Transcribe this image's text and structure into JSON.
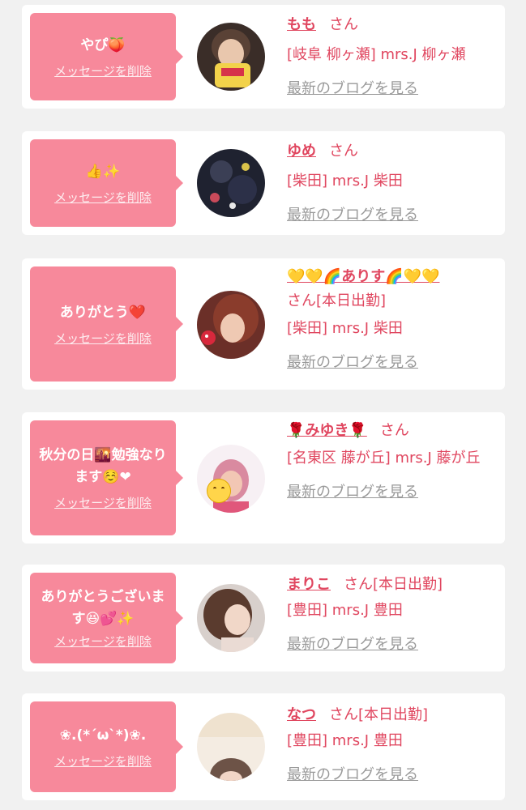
{
  "colors": {
    "bubble": "#f7899b",
    "accent_text": "#e0465f",
    "link_gray": "#999999",
    "page_bg": "#f1f1f1",
    "card_bg": "#ffffff"
  },
  "common": {
    "delete_label": "メッセージを削除",
    "blog_label": "最新のブログを見る",
    "san_label": "さん"
  },
  "cards": [
    {
      "message": "やぴ🍑",
      "name": "もも",
      "status": "",
      "shop": "[岐阜 柳ヶ瀬] mrs.J 柳ヶ瀬"
    },
    {
      "message": "👍✨",
      "name": "ゆめ",
      "status": "",
      "shop": "[柴田] mrs.J 柴田"
    },
    {
      "message": "ありがとう❤️",
      "name": "💛💛🌈ありす🌈💛💛",
      "status": "[本日出勤]",
      "shop": "[柴田] mrs.J 柴田"
    },
    {
      "message": "秋分の日🌇勉強なります☺️❤",
      "name": "🌹みゆき🌹",
      "status": "",
      "shop": "[名東区 藤が丘] mrs.J 藤が丘"
    },
    {
      "message": "ありがとうございます😆💕✨",
      "name": "まりこ",
      "status": "[本日出勤]",
      "shop": "[豊田] mrs.J 豊田"
    },
    {
      "message": "❀.(*´ω`*)❀.",
      "name": "なつ",
      "status": "[本日出勤]",
      "shop": "[豊田] mrs.J 豊田"
    }
  ]
}
